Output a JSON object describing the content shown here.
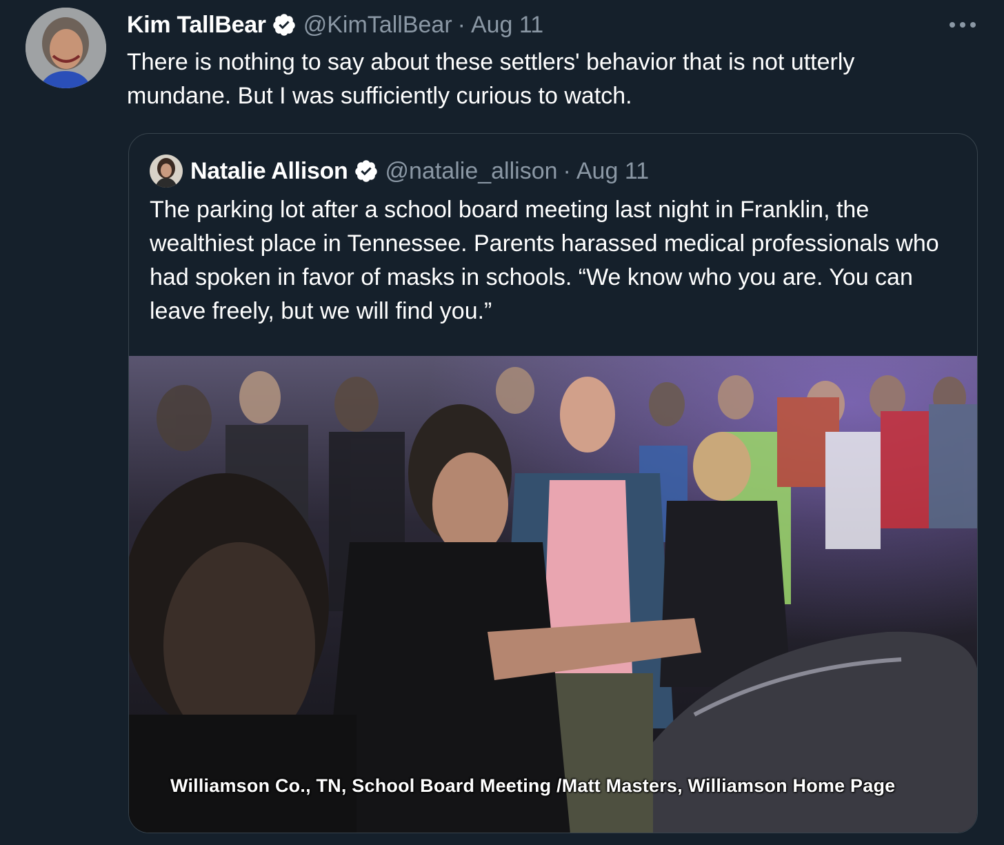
{
  "tweet": {
    "display_name": "Kim TallBear",
    "handle": "@KimTallBear",
    "separator": "·",
    "date": "Aug 11",
    "text": "There is nothing to say about these settlers' behavior that is not utterly mundane. But I was sufficiently curious to watch.",
    "avatar_icon": "user-avatar",
    "verified_icon": "verified-badge-icon",
    "more_icon": "more-options-icon"
  },
  "quoted_tweet": {
    "display_name": "Natalie Allison",
    "handle": "@natalie_allison",
    "separator": "·",
    "date": "Aug 11",
    "text": "The parking lot after a school board meeting last night in Franklin, the wealthiest place in Tennessee. Parents harassed medical professionals who had spoken in favor of masks in schools. “We know who you are. You can leave freely, but we will find you.”",
    "media_caption": "Williamson Co., TN, School Board Meeting /Matt Masters, Williamson Home Page"
  },
  "colors": {
    "background": "#15202b",
    "text_primary": "#ffffff",
    "text_secondary": "#8b98a5",
    "border": "#38444d"
  }
}
